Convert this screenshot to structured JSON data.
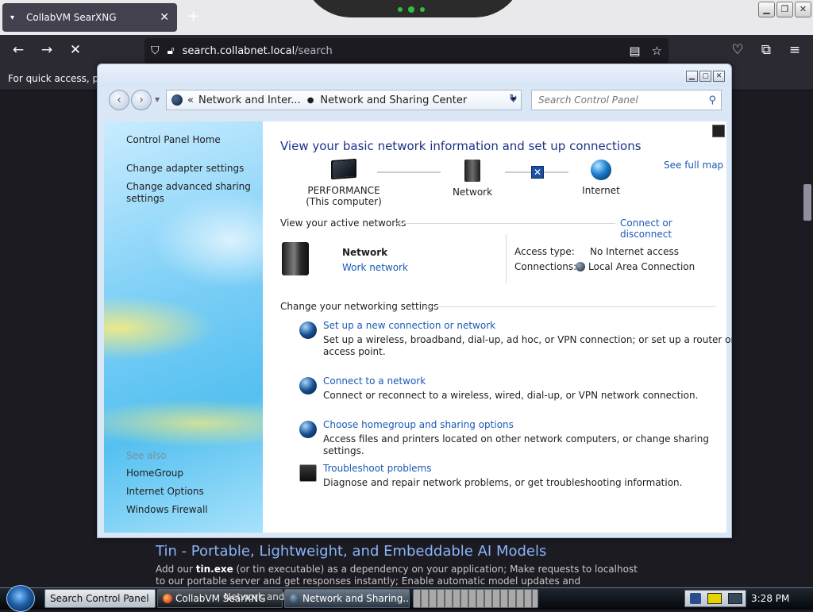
{
  "browser": {
    "tab_title": "CollabVM SearXNG",
    "tab_close": "✕",
    "newtab": "+",
    "url_domain": "search.collabnet.local",
    "url_path": "/search",
    "bookmark_hint": "For quick access, plac",
    "window_controls": [
      "▁",
      "❐",
      "✕"
    ]
  },
  "cp": {
    "path_crumb1": "Network and Inter...",
    "path_crumb2": "Network and Sharing Center",
    "search_placeholder": "Search Control Panel",
    "window_controls": [
      "▁",
      "▢",
      "✕"
    ],
    "sidebar": {
      "home": "Control Panel Home",
      "links": [
        "Change adapter settings",
        "Change advanced sharing settings"
      ],
      "see_also_label": "See also",
      "see_also": [
        "HomeGroup",
        "Internet Options",
        "Windows Firewall"
      ]
    },
    "heading": "View your basic network information and set up connections",
    "see_full_map": "See full map",
    "map": {
      "computer_name": "PERFORMANCE",
      "computer_sub": "(This computer)",
      "network": "Network",
      "internet": "Internet"
    },
    "active_label": "View your active networks",
    "connect_disconnect": "Connect or disconnect",
    "active_net": {
      "name": "Network",
      "type": "Work network",
      "access_type_label": "Access type:",
      "access_type_value": "No Internet access",
      "connections_label": "Connections:",
      "connections_value": "Local Area Connection"
    },
    "settings_label": "Change your networking settings",
    "tasks": [
      {
        "title": "Set up a new connection or network",
        "desc": "Set up a wireless, broadband, dial-up, ad hoc, or VPN connection; or set up a router or access point."
      },
      {
        "title": "Connect to a network",
        "desc": "Connect or reconnect to a wireless, wired, dial-up, or VPN network connection."
      },
      {
        "title": "Choose homegroup and sharing options",
        "desc": "Access files and printers located on other network computers, or change sharing settings."
      },
      {
        "title": "Troubleshoot problems",
        "desc": "Diagnose and repair network problems, or get troubleshooting information."
      }
    ]
  },
  "page": {
    "result_title": "Tin - Portable, Lightweight, and Embeddable AI Models",
    "snippet_pre": "Add our ",
    "snippet_bold": "tin.exe",
    "snippet_post": " (or tin executable) as a dependency on your application; Make requests to localhost to our portable server and get responses instantly; Enable automatic model updates and improvements (we"
  },
  "taskbar": {
    "buttons": [
      "Search Control Panel",
      "CollabVM SearXNG",
      "Network and Sharing...",
      ""
    ],
    "overlay_text": "Network and Sharing Center",
    "clock": "3:28 PM"
  },
  "colors": {
    "link": "#1b5ab5",
    "heading": "#1e3287",
    "browser_bg": "#1c1b22"
  }
}
